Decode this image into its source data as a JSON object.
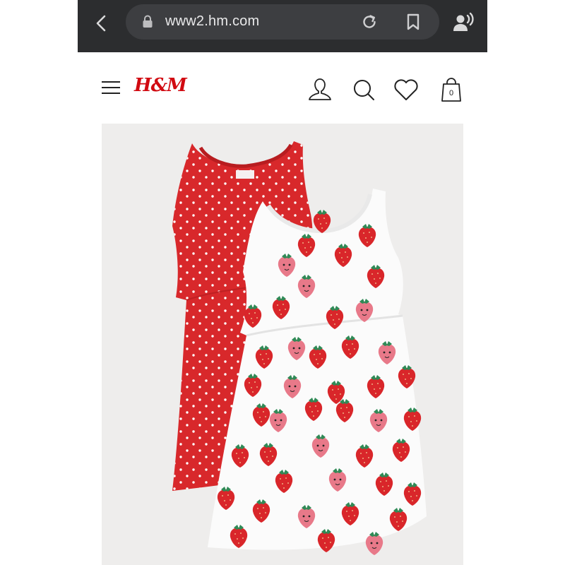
{
  "browser": {
    "url": "www2.hm.com"
  },
  "header": {
    "logo": "H&M",
    "bag_count": "0"
  },
  "product": {
    "image_description_icon": "product-photo"
  },
  "colors": {
    "brand_red": "#d10a11",
    "dress_red": "#d8282b",
    "browser_bar": "#2c2d2f"
  }
}
